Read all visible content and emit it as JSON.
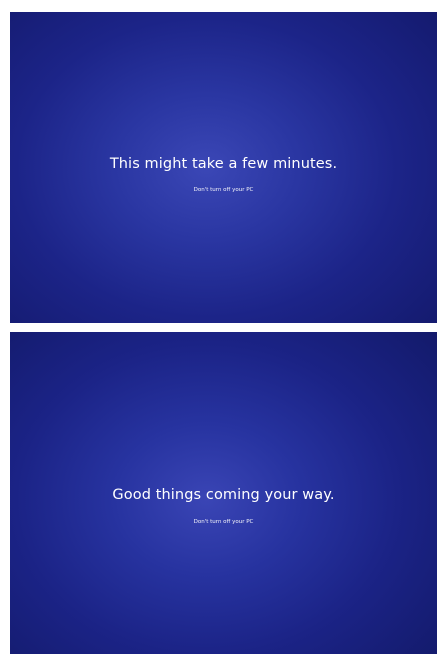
{
  "screens": [
    {
      "headline": "This might take a few minutes.",
      "subline": "Don't turn off your PC"
    },
    {
      "headline": "Good things coming your way.",
      "subline": "Don't turn off your PC"
    }
  ],
  "colors": {
    "background_center": "#3b47b6",
    "background_edge": "#141a6e",
    "text": "#ffffff",
    "page_border": "#ffffff"
  }
}
